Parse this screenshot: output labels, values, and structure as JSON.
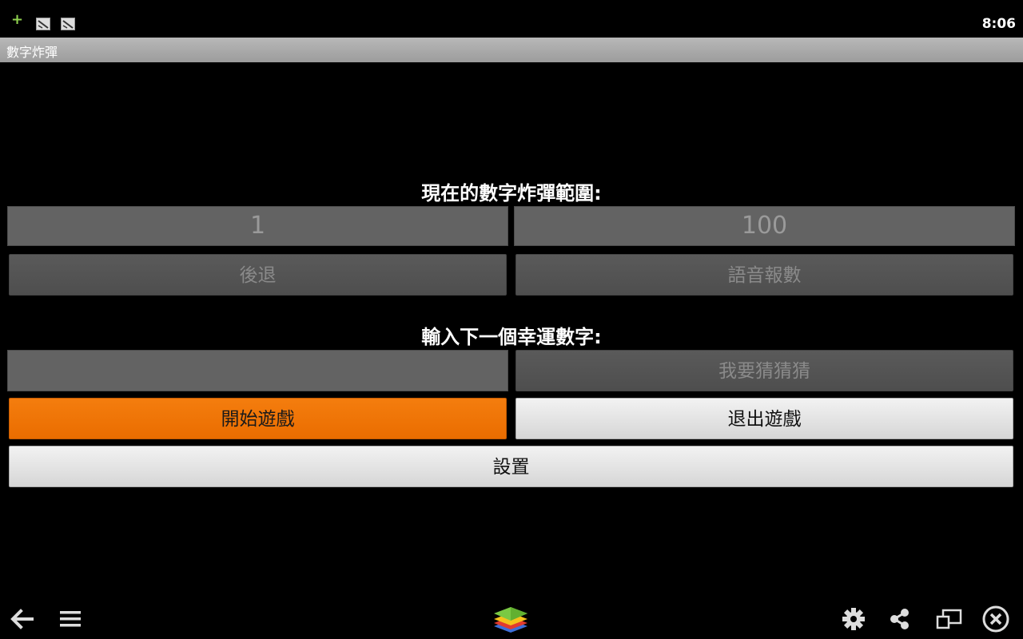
{
  "status_bar": {
    "time": "8:06",
    "notification_icons": [
      "plus-icon",
      "image-icon",
      "image-icon"
    ]
  },
  "app": {
    "title": "數字炸彈"
  },
  "range_section": {
    "heading": "現在的數字炸彈範圍:",
    "min_value": "1",
    "max_value": "100"
  },
  "buttons": {
    "back": "後退",
    "voice_report": "語音報數",
    "guess": "我要猜猜猜",
    "start_game": "開始遊戲",
    "exit_game": "退出遊戲",
    "settings": "設置"
  },
  "input_section": {
    "heading": "輸入下一個幸運數字:",
    "value": ""
  },
  "nav_bar": {
    "icons": [
      "back-arrow-icon",
      "menu-icon",
      "bluestacks-logo",
      "gear-icon",
      "share-icon",
      "window-icon",
      "close-icon"
    ]
  },
  "colors": {
    "accent": "#f0720a",
    "background": "#000000",
    "field": "#636363"
  }
}
